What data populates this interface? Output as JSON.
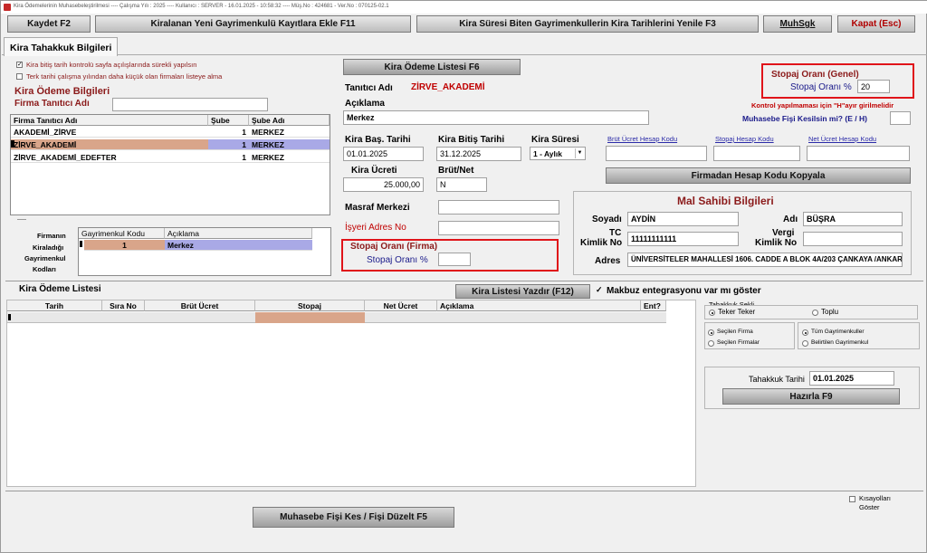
{
  "window": {
    "title": "Kira Ödemelerinin Muhasebeleştirilmesi  ----  Çalışma Yılı : 2025  ----  Kullanıcı : SERVER - 16.01.2025 - 10:58:32  ----  Müş.No : 424681 - Ver.No : 070125-02.1"
  },
  "toolbar": {
    "save": "Kaydet F2",
    "add_new": "Kiralanan Yeni Gayrimenkulü Kayıtlara Ekle F11",
    "renew_dates": "Kira Süresi Biten Gayrimenkullerin Kira Tarihlerini Yenile F3",
    "muhsgk": "MuhSgk",
    "close": "Kapat (Esc)"
  },
  "tab": {
    "label": "Kira Tahakkuk Bilgileri"
  },
  "options": {
    "check1": "Kira bitiş tarih kontrolü sayfa açılışlarında sürekli yapılsın",
    "check1_mark": "✓",
    "check2": "Terk tarihi çalışma yılından daha küçük olan firmaları listeye alma"
  },
  "payment_info": {
    "heading": "Kira Ödeme Bilgileri",
    "firm_label": "Firma Tanıtıcı Adı",
    "firm_value": ""
  },
  "firm_grid": {
    "headers": [
      "Firma Tanıtıcı Adı",
      "Şube",
      "Şube Adı"
    ],
    "rows": [
      {
        "name": "AKADEMİ_ZİRVE",
        "branch": "1",
        "branch_name": "MERKEZ"
      },
      {
        "name": "ZİRVE_AKADEMİ",
        "branch": "1",
        "branch_name": "MERKEZ"
      },
      {
        "name": "ZİRVE_AKADEMİ_EDEFTER",
        "branch": "1",
        "branch_name": "MERKEZ"
      }
    ]
  },
  "property_grid": {
    "side_label_1": "Firmanın",
    "side_label_2": "Kiraladığı",
    "side_label_3": "Gayrimenkul",
    "side_label_4": "Kodları",
    "headers": [
      "Gayrimenkul Kodu",
      "Açıklama"
    ],
    "rows": [
      {
        "code": "1",
        "desc": "Merkez"
      }
    ]
  },
  "center": {
    "payment_list_btn": "Kira Ödeme Listesi F6",
    "identifier_label": "Tanıtıcı Adı",
    "identifier_value": "ZİRVE_AKADEMİ",
    "description_label": "Açıklama",
    "description_value": "Merkez",
    "start_label": "Kira Baş. Tarihi",
    "start_value": "01.01.2025",
    "end_label": "Kira Bitiş Tarihi",
    "end_value": "31.12.2025",
    "duration_label": "Kira Süresi",
    "duration_value": "1 - Aylık",
    "fee_label": "Kira Ücreti",
    "fee_value": "25.000,00",
    "gross_net_label": "Brüt/Net",
    "gross_net_value": "N",
    "cost_center_label": "Masraf Merkezi",
    "cost_center_value": "",
    "workplace_label": "İşyeri Adres No",
    "workplace_value": "",
    "firm_stopaj_title": "Stopaj Oranı (Firma)",
    "firm_stopaj_label": "Stopaj Oranı %",
    "firm_stopaj_value": ""
  },
  "account_codes": {
    "gross_label": "Brüt Ücret Hesap Kodu",
    "stopaj_label": "Stopaj Hesap Kodu",
    "net_label": "Net Ücret Hesap Kodu",
    "copy_btn": "Firmadan Hesap Kodu Kopyala"
  },
  "general_stopaj": {
    "title": "Stopaj Oranı (Genel)",
    "label": "Stopaj Oranı %",
    "value": "20",
    "warning": "Kontrol yapılmaması için \"H\"ayır girilmelidir",
    "voucher_label": "Muhasebe Fişi Kesilsin mi? (E / H)",
    "voucher_value": ""
  },
  "owner": {
    "title": "Mal Sahibi Bilgileri",
    "surname_label": "Soyadı",
    "surname_value": "AYDİN",
    "name_label": "Adı",
    "name_value": "BÜŞRA",
    "tc_label_1": "TC",
    "tc_label_2": "Kimlik No",
    "tc_value": "11111111111",
    "tax_label_1": "Vergi",
    "tax_label_2": "Kimlik No",
    "tax_value": "",
    "address_label": "Adres",
    "address_value": "ÜNİVERSİTELER MAHALLESİ 1606. CADDE A BLOK 4A/203 ÇANKAYA /ANKARA"
  },
  "list_section": {
    "title": "Kira Ödeme Listesi",
    "print_btn": "Kira Listesi Yazdır (F12)",
    "receipt_label": "Makbuz entegrasyonu var mı göster",
    "receipt_mark": "✓",
    "headers": [
      "Tarih",
      "Sıra No",
      "Brüt Ücret",
      "Stopaj",
      "Net Ücret",
      "Açıklama",
      "Ent?"
    ]
  },
  "accrual": {
    "shape_title": "Tahakkuk Şekli",
    "single": "Teker Teker",
    "bulk": "Toplu",
    "selected_firm": "Seçilen Firma",
    "selected_firms": "Seçilen Firmalar",
    "all_properties": "Tüm Gayrimenkuller",
    "specific_property": "Belirtilen Gayrimenkul",
    "date_label": "Tahakkuk Tarihi",
    "date_value": "01.01.2025",
    "prepare_btn": "Hazırla F9"
  },
  "footer": {
    "voucher_btn": "Muhasebe Fişi Kes / Fişi Düzelt F5",
    "shortcuts_label_1": "Kısayolları",
    "shortcuts_label_2": "Göster"
  }
}
